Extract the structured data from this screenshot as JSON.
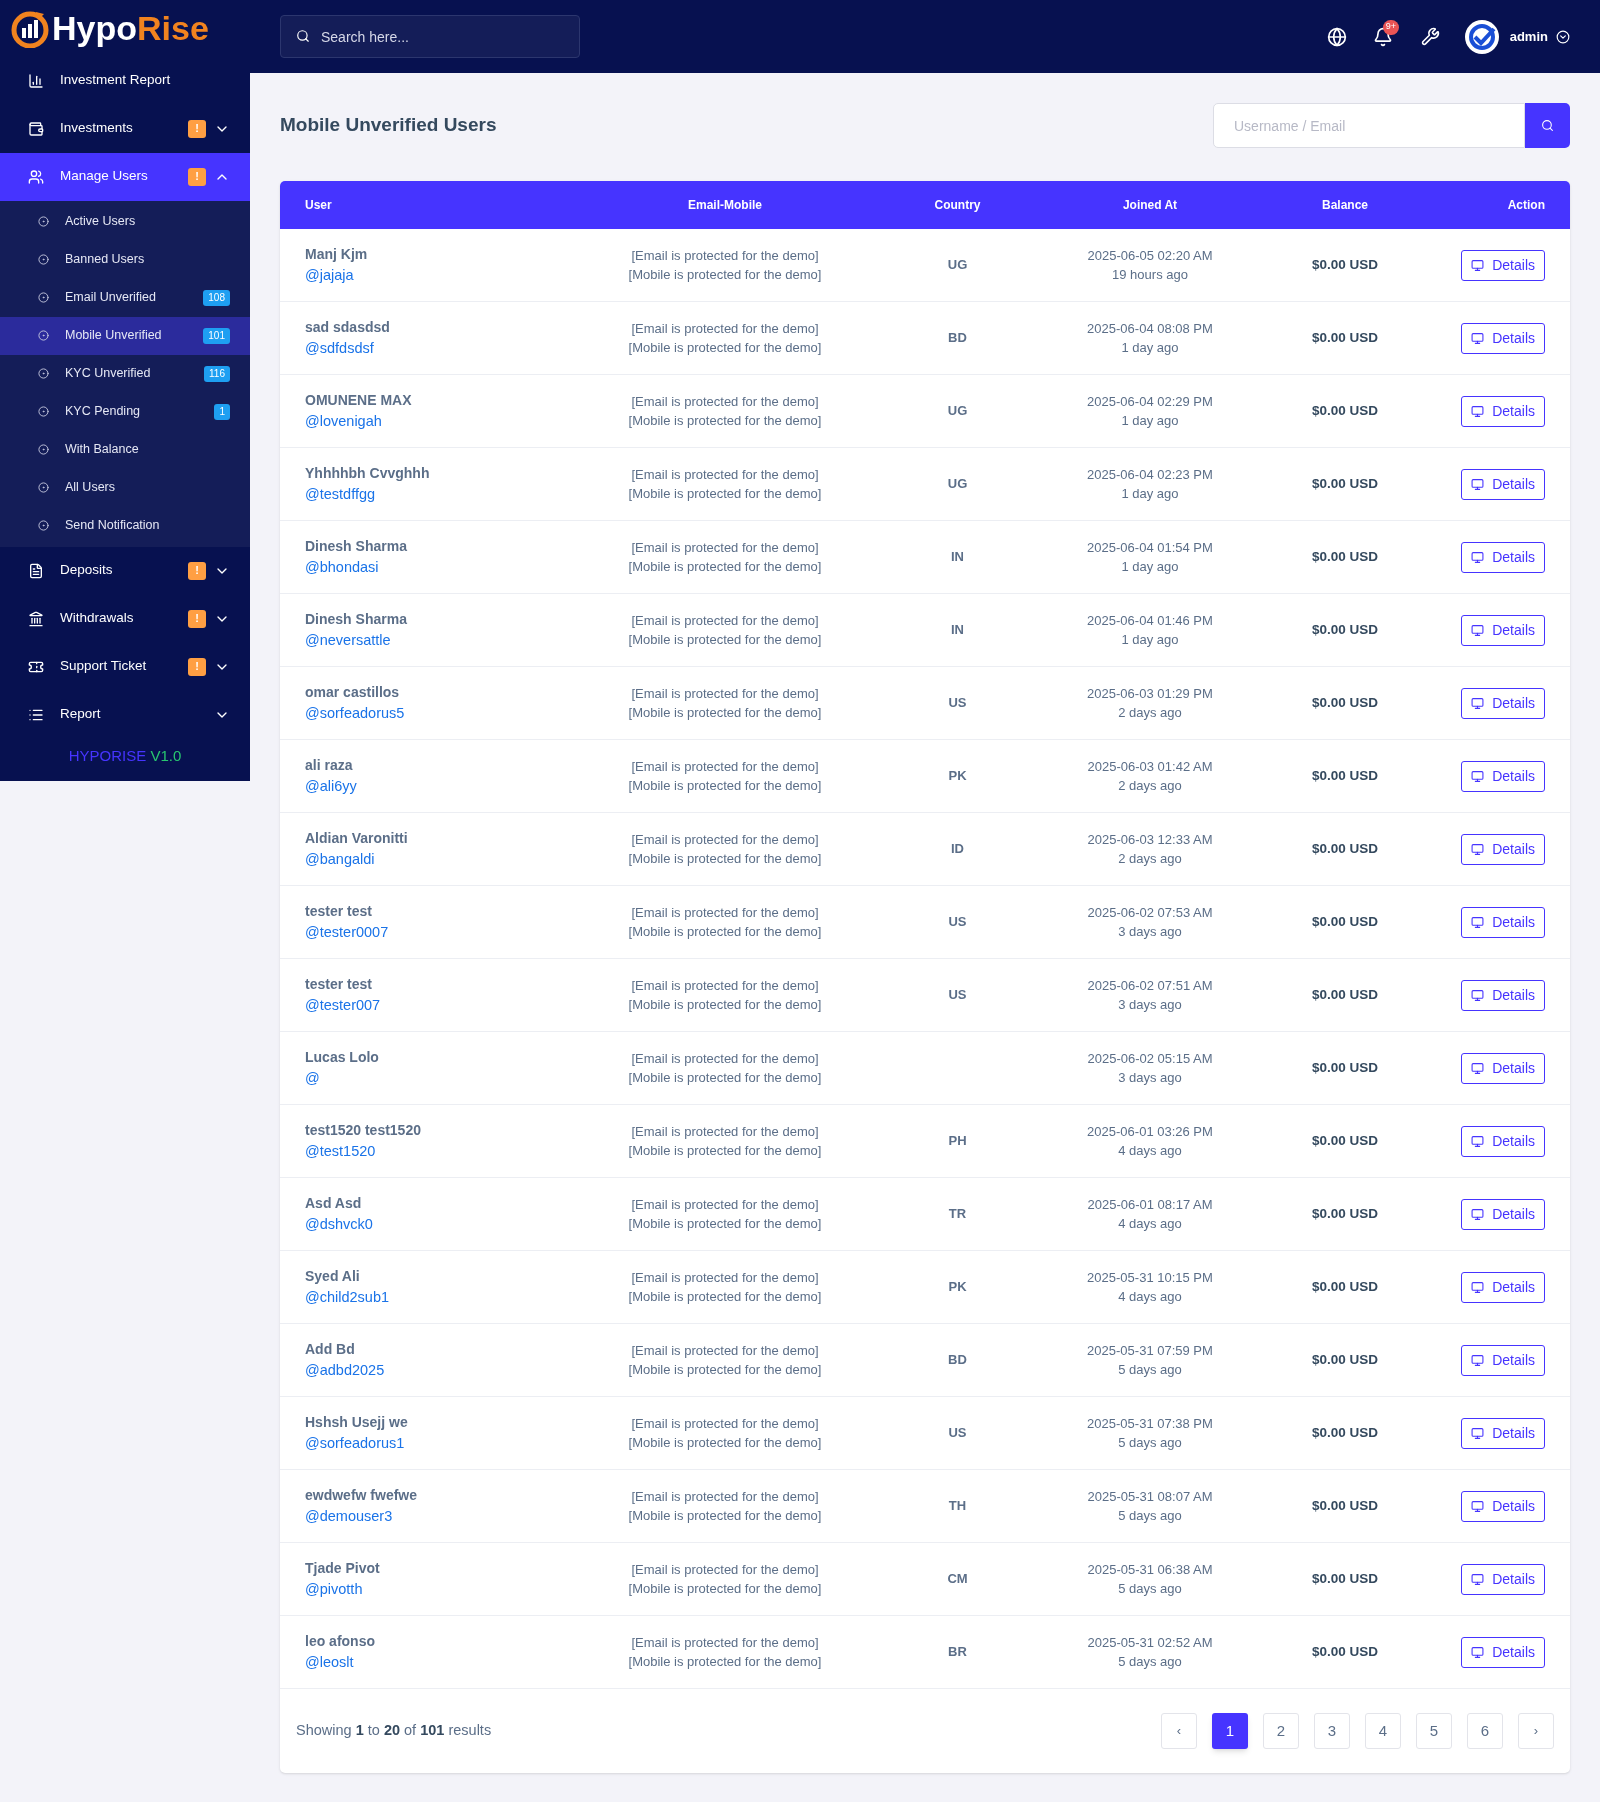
{
  "logo": {
    "part_1": "Hypo",
    "part_2": "Rise"
  },
  "sidebar": {
    "items": [
      {
        "kind": "link",
        "label": "Investment Report"
      },
      {
        "kind": "group",
        "label": "Investments",
        "badge": "!",
        "expanded": false
      },
      {
        "kind": "group",
        "label": "Manage Users",
        "badge": "!",
        "expanded": true,
        "children": [
          {
            "label": "Active Users",
            "selected": false
          },
          {
            "label": "Banned Users",
            "selected": false
          },
          {
            "label": "Email Unverified",
            "badge": "108",
            "selected": false
          },
          {
            "label": "Mobile Unverified",
            "badge": "101",
            "selected": true
          },
          {
            "label": "KYC Unverified",
            "badge": "116",
            "selected": false
          },
          {
            "label": "KYC Pending",
            "badge": "1",
            "selected": false
          },
          {
            "label": "With Balance",
            "selected": false
          },
          {
            "label": "All Users",
            "selected": false
          },
          {
            "label": "Send Notification",
            "selected": false
          }
        ]
      },
      {
        "kind": "group",
        "label": "Deposits",
        "badge": "!",
        "expanded": false
      },
      {
        "kind": "group",
        "label": "Withdrawals",
        "badge": "!",
        "expanded": false
      },
      {
        "kind": "group",
        "label": "Support Ticket",
        "badge": "!",
        "expanded": false
      },
      {
        "kind": "group",
        "label": "Report",
        "expanded": false
      }
    ],
    "version": {
      "name": "HYPORISE",
      "number": "V1.0"
    }
  },
  "header": {
    "search": {
      "placeholder": "Search here..."
    },
    "notifications": "9+",
    "user": "admin"
  },
  "page": {
    "title": "Mobile Unverified Users",
    "search": {
      "placeholder": "Username / Email"
    }
  },
  "table": {
    "columns": [
      "User",
      "Email-Mobile",
      "Country",
      "Joined At",
      "Balance",
      "Action"
    ],
    "rows": [
      {
        "name": "Manj Kjm",
        "username": "@jajaja",
        "email": "[Email is protected for the demo]",
        "mobile": "[Mobile is protected for the demo]",
        "country": "UG",
        "joined": "2025-06-05 02:20 AM",
        "ago": "19 hours ago",
        "balance": "$0.00 USD",
        "action": "Details"
      },
      {
        "name": "sad sdasdsd",
        "username": "@sdfdsdsf",
        "email": "[Email is protected for the demo]",
        "mobile": "[Mobile is protected for the demo]",
        "country": "BD",
        "joined": "2025-06-04 08:08 PM",
        "ago": "1 day ago",
        "balance": "$0.00 USD",
        "action": "Details"
      },
      {
        "name": "OMUNENE MAX",
        "username": "@lovenigah",
        "email": "[Email is protected for the demo]",
        "mobile": "[Mobile is protected for the demo]",
        "country": "UG",
        "joined": "2025-06-04 02:29 PM",
        "ago": "1 day ago",
        "balance": "$0.00 USD",
        "action": "Details"
      },
      {
        "name": "Yhhhhbh Cvvghhh",
        "username": "@testdffgg",
        "email": "[Email is protected for the demo]",
        "mobile": "[Mobile is protected for the demo]",
        "country": "UG",
        "joined": "2025-06-04 02:23 PM",
        "ago": "1 day ago",
        "balance": "$0.00 USD",
        "action": "Details"
      },
      {
        "name": "Dinesh Sharma",
        "username": "@bhondasi",
        "email": "[Email is protected for the demo]",
        "mobile": "[Mobile is protected for the demo]",
        "country": "IN",
        "joined": "2025-06-04 01:54 PM",
        "ago": "1 day ago",
        "balance": "$0.00 USD",
        "action": "Details"
      },
      {
        "name": "Dinesh Sharma",
        "username": "@neversattle",
        "email": "[Email is protected for the demo]",
        "mobile": "[Mobile is protected for the demo]",
        "country": "IN",
        "joined": "2025-06-04 01:46 PM",
        "ago": "1 day ago",
        "balance": "$0.00 USD",
        "action": "Details"
      },
      {
        "name": "omar castillos",
        "username": "@sorfeadorus5",
        "email": "[Email is protected for the demo]",
        "mobile": "[Mobile is protected for the demo]",
        "country": "US",
        "joined": "2025-06-03 01:29 PM",
        "ago": "2 days ago",
        "balance": "$0.00 USD",
        "action": "Details"
      },
      {
        "name": "ali raza",
        "username": "@ali6yy",
        "email": "[Email is protected for the demo]",
        "mobile": "[Mobile is protected for the demo]",
        "country": "PK",
        "joined": "2025-06-03 01:42 AM",
        "ago": "2 days ago",
        "balance": "$0.00 USD",
        "action": "Details"
      },
      {
        "name": "Aldian Varonitti",
        "username": "@bangaldi",
        "email": "[Email is protected for the demo]",
        "mobile": "[Mobile is protected for the demo]",
        "country": "ID",
        "joined": "2025-06-03 12:33 AM",
        "ago": "2 days ago",
        "balance": "$0.00 USD",
        "action": "Details"
      },
      {
        "name": "tester test",
        "username": "@tester0007",
        "email": "[Email is protected for the demo]",
        "mobile": "[Mobile is protected for the demo]",
        "country": "US",
        "joined": "2025-06-02 07:53 AM",
        "ago": "3 days ago",
        "balance": "$0.00 USD",
        "action": "Details"
      },
      {
        "name": "tester test",
        "username": "@tester007",
        "email": "[Email is protected for the demo]",
        "mobile": "[Mobile is protected for the demo]",
        "country": "US",
        "joined": "2025-06-02 07:51 AM",
        "ago": "3 days ago",
        "balance": "$0.00 USD",
        "action": "Details"
      },
      {
        "name": "Lucas Lolo",
        "username": "@",
        "email": "[Email is protected for the demo]",
        "mobile": "[Mobile is protected for the demo]",
        "joined": "2025-06-02 05:15 AM",
        "ago": "3 days ago",
        "balance": "$0.00 USD",
        "action": "Details"
      },
      {
        "name": "test1520 test1520",
        "username": "@test1520",
        "email": "[Email is protected for the demo]",
        "mobile": "[Mobile is protected for the demo]",
        "country": "PH",
        "joined": "2025-06-01 03:26 PM",
        "ago": "4 days ago",
        "balance": "$0.00 USD",
        "action": "Details"
      },
      {
        "name": "Asd Asd",
        "username": "@dshvck0",
        "email": "[Email is protected for the demo]",
        "mobile": "[Mobile is protected for the demo]",
        "country": "TR",
        "joined": "2025-06-01 08:17 AM",
        "ago": "4 days ago",
        "balance": "$0.00 USD",
        "action": "Details"
      },
      {
        "name": "Syed Ali",
        "username": "@child2sub1",
        "email": "[Email is protected for the demo]",
        "mobile": "[Mobile is protected for the demo]",
        "country": "PK",
        "joined": "2025-05-31 10:15 PM",
        "ago": "4 days ago",
        "balance": "$0.00 USD",
        "action": "Details"
      },
      {
        "name": "Add Bd",
        "username": "@adbd2025",
        "email": "[Email is protected for the demo]",
        "mobile": "[Mobile is protected for the demo]",
        "country": "BD",
        "joined": "2025-05-31 07:59 PM",
        "ago": "5 days ago",
        "balance": "$0.00 USD",
        "action": "Details"
      },
      {
        "name": "Hshsh Usejj we",
        "username": "@sorfeadorus1",
        "email": "[Email is protected for the demo]",
        "mobile": "[Mobile is protected for the demo]",
        "country": "US",
        "joined": "2025-05-31 07:38 PM",
        "ago": "5 days ago",
        "balance": "$0.00 USD",
        "action": "Details"
      },
      {
        "name": "ewdwefw fwefwe",
        "username": "@demouser3",
        "email": "[Email is protected for the demo]",
        "mobile": "[Mobile is protected for the demo]",
        "country": "TH",
        "joined": "2025-05-31 08:07 AM",
        "ago": "5 days ago",
        "balance": "$0.00 USD",
        "action": "Details"
      },
      {
        "name": "Tjade Pivot",
        "username": "@pivotth",
        "email": "[Email is protected for the demo]",
        "mobile": "[Mobile is protected for the demo]",
        "country": "CM",
        "joined": "2025-05-31 06:38 AM",
        "ago": "5 days ago",
        "balance": "$0.00 USD",
        "action": "Details"
      },
      {
        "name": "leo afonso",
        "username": "@leoslt",
        "email": "[Email is protected for the demo]",
        "mobile": "[Mobile is protected for the demo]",
        "country": "BR",
        "joined": "2025-05-31 02:52 AM",
        "ago": "5 days ago",
        "balance": "$0.00 USD",
        "action": "Details"
      }
    ]
  },
  "footer": {
    "summary": "Showing **1** to **20** of **101** results"
  },
  "pagination": {
    "previous": "‹",
    "next": "›",
    "pages": [
      {
        "label": "1",
        "selected": true
      },
      {
        "label": "2",
        "selected": false
      },
      {
        "label": "3",
        "selected": false
      },
      {
        "label": "4",
        "selected": false
      },
      {
        "label": "5",
        "selected": false
      },
      {
        "label": "6",
        "selected": false
      }
    ]
  }
}
